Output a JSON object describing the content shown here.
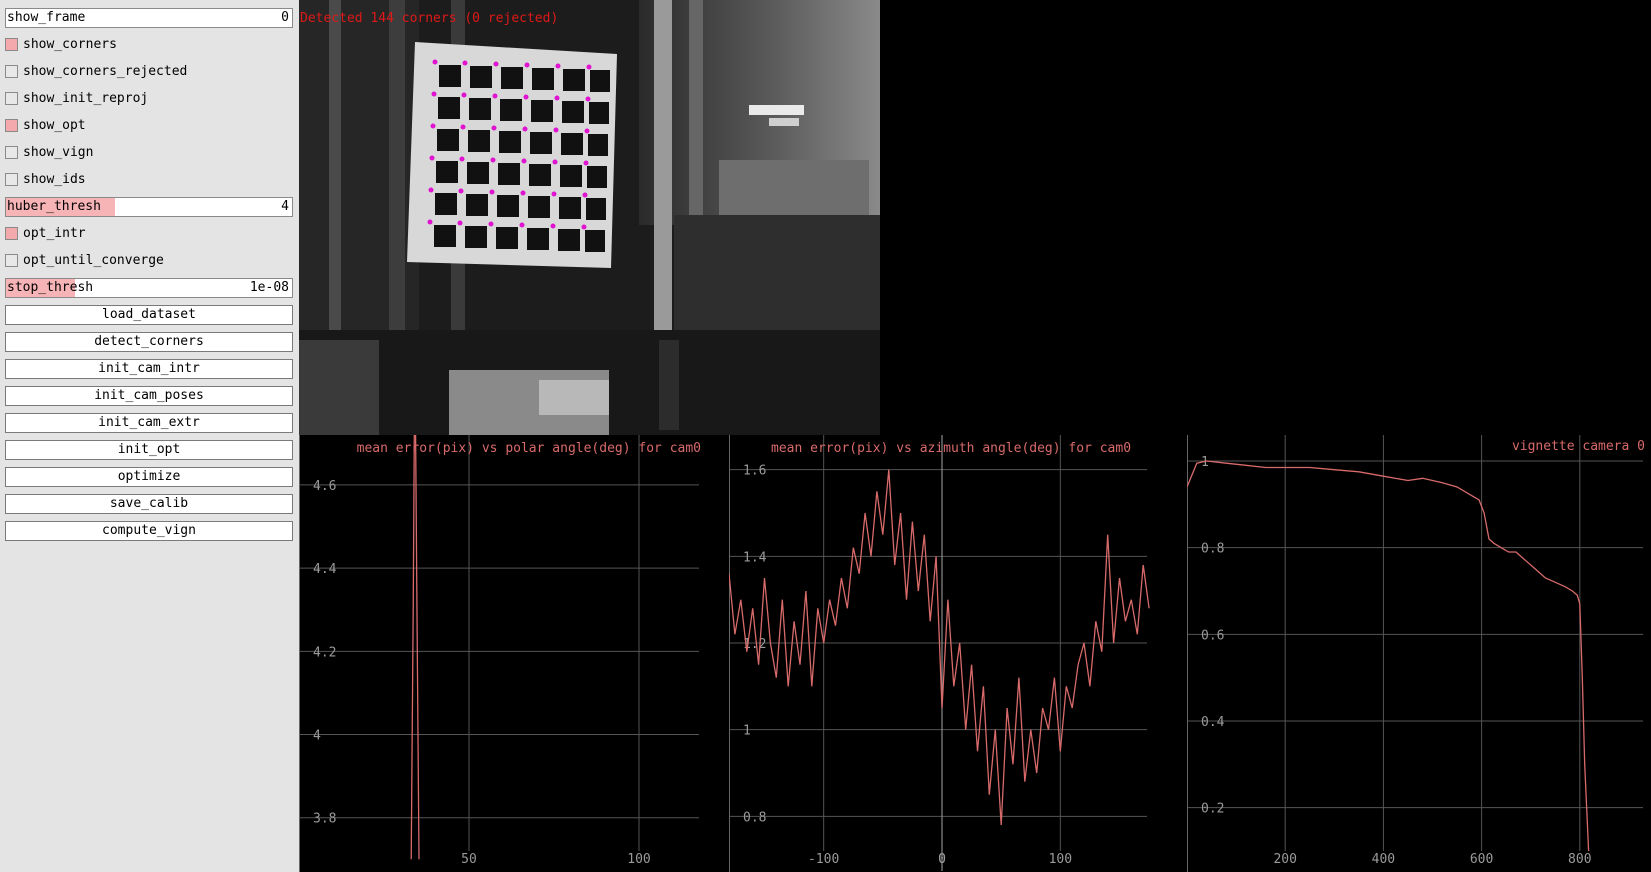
{
  "panel": {
    "show_frame": {
      "label": "show_frame",
      "value": "0"
    },
    "show_corners": {
      "label": "show_corners",
      "checked": true
    },
    "show_corners_rejected": {
      "label": "show_corners_rejected",
      "checked": false
    },
    "show_init_reproj": {
      "label": "show_init_reproj",
      "checked": false
    },
    "show_opt": {
      "label": "show_opt",
      "checked": true
    },
    "show_vign": {
      "label": "show_vign",
      "checked": false
    },
    "show_ids": {
      "label": "show_ids",
      "checked": false
    },
    "huber_thresh": {
      "label": "huber_thresh",
      "value": "4",
      "fill": 0.38
    },
    "opt_intr": {
      "label": "opt_intr",
      "checked": true
    },
    "opt_until_converge": {
      "label": "opt_until_converge",
      "checked": false
    },
    "stop_thresh": {
      "label": "stop_thresh",
      "value": "1e-08",
      "fill": 0.24
    },
    "buttons": {
      "load_dataset": "load_dataset",
      "detect_corners": "detect_corners",
      "init_cam_intr": "init_cam_intr",
      "init_cam_poses": "init_cam_poses",
      "init_cam_extr": "init_cam_extr",
      "init_opt": "init_opt",
      "optimize": "optimize",
      "save_calib": "save_calib",
      "compute_vign": "compute_vign"
    }
  },
  "image_view": {
    "status": "Detected 144 corners (0 rejected)"
  },
  "colors": {
    "accent": "#f4a9ad",
    "plot_line": "#d86a6a",
    "status_text": "#e01818",
    "grid": "#555555"
  },
  "chart_data": [
    {
      "type": "line",
      "title": "mean error(pix) vs polar angle(deg) for cam0",
      "xlim": [
        0,
        120
      ],
      "ylim": [
        3.72,
        4.72
      ],
      "xticks": [
        50,
        100
      ],
      "yticks": [
        3.8,
        4,
        4.2,
        4.4,
        4.6
      ],
      "ytick_labels": [
        "3.8",
        "4",
        "4.2",
        "4.4",
        "4.6"
      ],
      "x": [
        33,
        33.6,
        33.9,
        34.3,
        34.8,
        35.3
      ],
      "y": [
        3.7,
        4.3,
        4.72,
        4.72,
        4.2,
        3.7
      ]
    },
    {
      "type": "line",
      "title": "mean error(pix) vs azimuth angle(deg) for cam0",
      "xlim": [
        -180,
        180
      ],
      "ylim": [
        0.72,
        1.68
      ],
      "xticks": [
        -100,
        0,
        100
      ],
      "yticks": [
        0.8,
        1,
        1.2,
        1.4,
        1.6
      ],
      "ytick_labels": [
        "0.8",
        "1",
        "1.2",
        "1.4",
        "1.6"
      ],
      "x": [
        -180,
        -175,
        -170,
        -165,
        -160,
        -155,
        -150,
        -145,
        -140,
        -135,
        -130,
        -125,
        -120,
        -115,
        -110,
        -105,
        -100,
        -95,
        -90,
        -85,
        -80,
        -75,
        -70,
        -65,
        -60,
        -55,
        -50,
        -45,
        -40,
        -35,
        -30,
        -25,
        -20,
        -15,
        -10,
        -5,
        0,
        5,
        10,
        15,
        20,
        25,
        30,
        35,
        40,
        45,
        50,
        55,
        60,
        65,
        70,
        75,
        80,
        85,
        90,
        95,
        100,
        105,
        110,
        115,
        120,
        125,
        130,
        135,
        140,
        145,
        150,
        155,
        160,
        165,
        170,
        175
      ],
      "y": [
        1.36,
        1.22,
        1.3,
        1.18,
        1.28,
        1.15,
        1.35,
        1.2,
        1.12,
        1.3,
        1.1,
        1.25,
        1.15,
        1.32,
        1.1,
        1.28,
        1.2,
        1.3,
        1.24,
        1.35,
        1.28,
        1.42,
        1.36,
        1.5,
        1.4,
        1.55,
        1.45,
        1.6,
        1.38,
        1.5,
        1.3,
        1.48,
        1.32,
        1.45,
        1.25,
        1.4,
        1.05,
        1.3,
        1.1,
        1.2,
        1.0,
        1.15,
        0.95,
        1.1,
        0.85,
        1.0,
        0.78,
        1.05,
        0.92,
        1.12,
        0.88,
        1.0,
        0.9,
        1.05,
        1.0,
        1.12,
        0.95,
        1.1,
        1.05,
        1.15,
        1.2,
        1.1,
        1.25,
        1.18,
        1.45,
        1.2,
        1.35,
        1.25,
        1.3,
        1.22,
        1.38,
        1.28
      ]
    },
    {
      "type": "line",
      "title": "vignette camera 0",
      "xlim": [
        0,
        945
      ],
      "ylim": [
        0.1,
        1.06
      ],
      "xticks": [
        200,
        400,
        600,
        800
      ],
      "yticks": [
        0.2,
        0.4,
        0.6,
        0.8,
        1
      ],
      "ytick_labels": [
        "0.2",
        "0.4",
        "0.6",
        "0.8",
        "1"
      ],
      "x": [
        0,
        20,
        40,
        80,
        120,
        160,
        200,
        250,
        300,
        350,
        400,
        450,
        480,
        520,
        550,
        580,
        595,
        605,
        615,
        625,
        640,
        655,
        670,
        690,
        710,
        730,
        750,
        770,
        785,
        795,
        800,
        805,
        810,
        818
      ],
      "y": [
        0.94,
        0.995,
        1.0,
        0.995,
        0.99,
        0.985,
        0.985,
        0.985,
        0.98,
        0.975,
        0.965,
        0.955,
        0.96,
        0.95,
        0.94,
        0.92,
        0.91,
        0.88,
        0.82,
        0.81,
        0.8,
        0.79,
        0.79,
        0.77,
        0.75,
        0.73,
        0.72,
        0.71,
        0.7,
        0.69,
        0.67,
        0.5,
        0.3,
        0.1
      ]
    }
  ]
}
